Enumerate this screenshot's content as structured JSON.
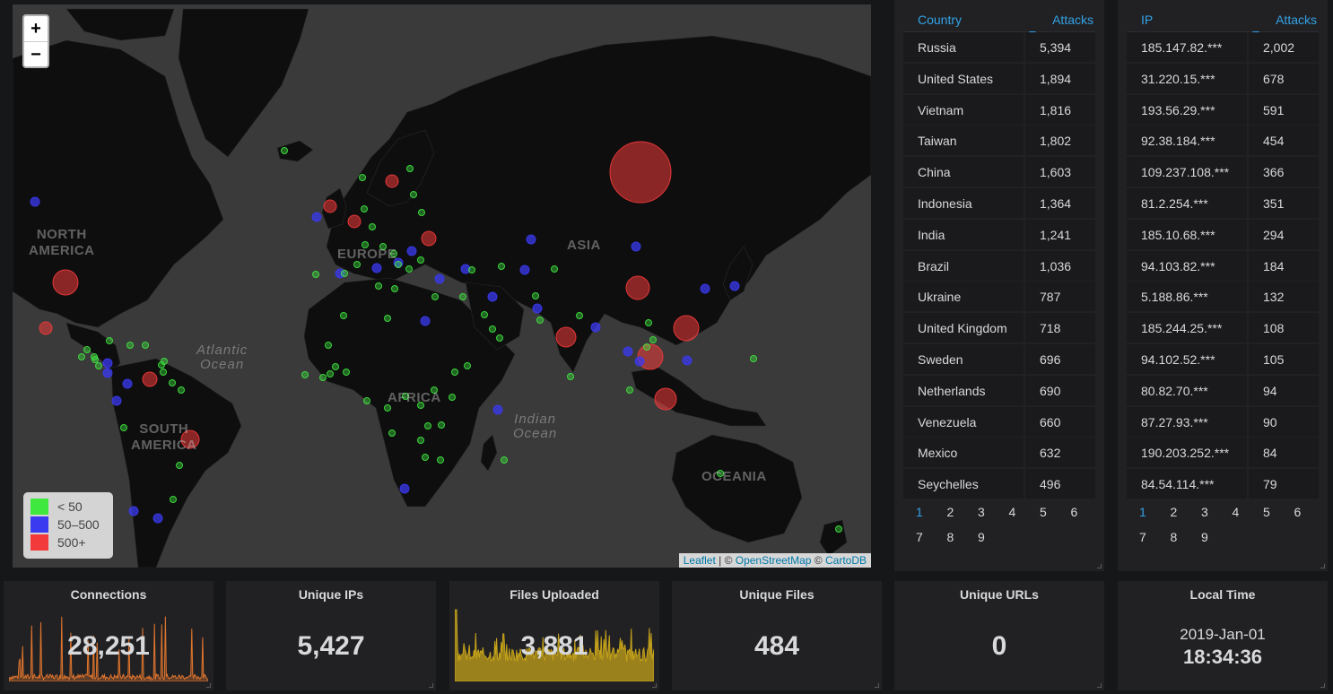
{
  "map": {
    "zoom_in": "+",
    "zoom_out": "−",
    "continent_labels": {
      "north_america": "NORTH\nAMERICA",
      "south_america": "SOUTH\nAMERICA",
      "europe": "EUROPE",
      "asia": "ASIA",
      "africa": "AFRICA",
      "oceania": "OCEANIA"
    },
    "ocean_labels": {
      "atlantic": "Atlantic\nOcean",
      "indian": "Indian\nOcean"
    },
    "legend": [
      {
        "label": "< 50",
        "color": "#3fe83f"
      },
      {
        "label": "50–500",
        "color": "#3a3af0"
      },
      {
        "label": "500+",
        "color": "#f23a3a"
      }
    ],
    "attribution": {
      "leaflet": "Leaflet",
      "sep1": " | © ",
      "osm": "OpenStreetMap",
      "sep2": " © ",
      "carto": "CartoDB"
    }
  },
  "country_table": {
    "col1": "Country",
    "col2": "Attacks",
    "rows": [
      [
        "Russia",
        "5,394"
      ],
      [
        "United States",
        "1,894"
      ],
      [
        "Vietnam",
        "1,816"
      ],
      [
        "Taiwan",
        "1,802"
      ],
      [
        "China",
        "1,603"
      ],
      [
        "Indonesia",
        "1,364"
      ],
      [
        "India",
        "1,241"
      ],
      [
        "Brazil",
        "1,036"
      ],
      [
        "Ukraine",
        "787"
      ],
      [
        "United Kingdom",
        "718"
      ],
      [
        "Sweden",
        "696"
      ],
      [
        "Netherlands",
        "690"
      ],
      [
        "Venezuela",
        "660"
      ],
      [
        "Mexico",
        "632"
      ],
      [
        "Seychelles",
        "496"
      ]
    ],
    "pages": [
      "1",
      "2",
      "3",
      "4",
      "5",
      "6",
      "7",
      "8",
      "9"
    ],
    "active_page": "1"
  },
  "ip_table": {
    "col1": "IP",
    "col2": "Attacks",
    "rows": [
      [
        "185.147.82.***",
        "2,002"
      ],
      [
        "31.220.15.***",
        "678"
      ],
      [
        "193.56.29.***",
        "591"
      ],
      [
        "92.38.184.***",
        "454"
      ],
      [
        "109.237.108.***",
        "366"
      ],
      [
        "81.2.254.***",
        "351"
      ],
      [
        "185.10.68.***",
        "294"
      ],
      [
        "94.103.82.***",
        "184"
      ],
      [
        "5.188.86.***",
        "132"
      ],
      [
        "185.244.25.***",
        "108"
      ],
      [
        "94.102.52.***",
        "105"
      ],
      [
        "80.82.70.***",
        "94"
      ],
      [
        "87.27.93.***",
        "90"
      ],
      [
        "190.203.252.***",
        "84"
      ],
      [
        "84.54.114.***",
        "79"
      ]
    ],
    "pages": [
      "1",
      "2",
      "3",
      "4",
      "5",
      "6",
      "7",
      "8",
      "9"
    ],
    "active_page": "1"
  },
  "stats": {
    "connections": {
      "title": "Connections",
      "value": "28,251",
      "color": "#e0752d"
    },
    "unique_ips": {
      "title": "Unique IPs",
      "value": "5,427"
    },
    "files_uploaded": {
      "title": "Files Uploaded",
      "value": "3,881",
      "color": "#c4a21a"
    },
    "unique_files": {
      "title": "Unique Files",
      "value": "484"
    },
    "unique_urls": {
      "title": "Unique URLs",
      "value": "0"
    },
    "local_time": {
      "title": "Local Time",
      "date": "2019-Jan-01",
      "time": "18:34:36"
    }
  }
}
